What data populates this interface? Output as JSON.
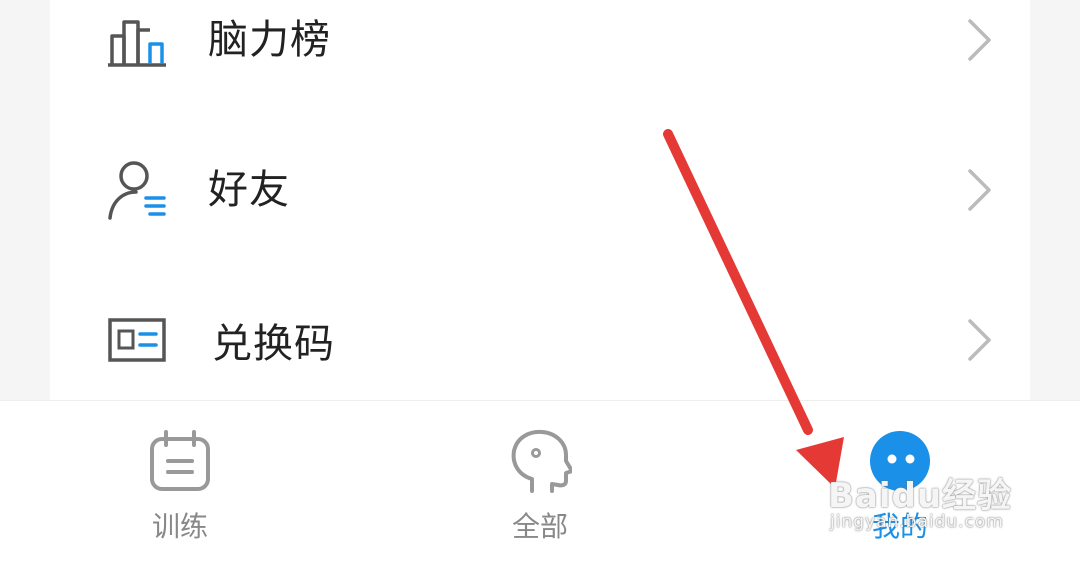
{
  "menu": {
    "items": [
      {
        "label": "脑力榜",
        "icon": "leaderboard-bar-chart-icon"
      },
      {
        "label": "好友",
        "icon": "friends-person-icon"
      },
      {
        "label": "兑换码",
        "icon": "redeem-code-card-icon"
      }
    ],
    "chevron_icon": "chevron-right-icon"
  },
  "tabbar": {
    "tabs": [
      {
        "label": "训练",
        "icon": "calendar-training-icon",
        "active": false
      },
      {
        "label": "全部",
        "icon": "head-profile-icon",
        "active": false
      },
      {
        "label": "我的",
        "icon": "mine-face-icon",
        "active": true
      }
    ]
  },
  "overlay": {
    "arrow_color": "#e53935",
    "watermark_main": "Baidu经验",
    "watermark_sub": "jingyan.baidu.com"
  },
  "colors": {
    "accent": "#1a90e8",
    "icon_gray": "#555555",
    "chevron": "#bbbbbb",
    "tab_inactive": "#888888"
  }
}
